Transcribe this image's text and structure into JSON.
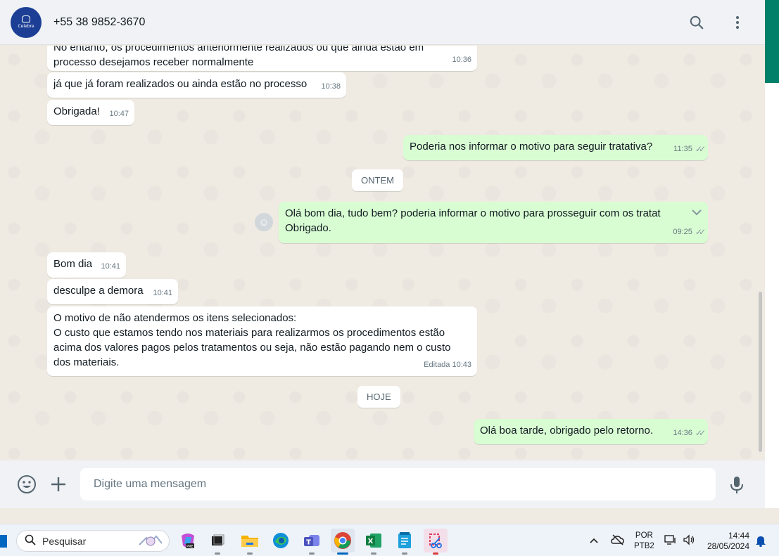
{
  "header": {
    "avatar_text": "Celebre",
    "contact_name": "+55 38 9852-3670",
    "search_icon": "search-icon",
    "menu_icon": "more-vertical-icon"
  },
  "messages": {
    "m1_text_line1": "No entanto, os procedimentos anteriormente realizados ou que ainda estão em",
    "m1_text_line2": "processo desejamos receber normalmente",
    "m1_time": "10:36",
    "m2_text": "já que já foram realizados ou ainda estão no processo",
    "m2_time": "10:38",
    "m3_text": "Obrigada!",
    "m3_time": "10:47",
    "m4_text": "Poderia nos informar o motivo para seguir tratativa?",
    "m4_time": "11:35",
    "day1": "ONTEM",
    "m5_text_line1": "Olá bom dia, tudo bem? poderia informar o motivo para prosseguir com os tratat",
    "m5_text_line2": "Obrigado.",
    "m5_time": "09:25",
    "m6_text": "Bom dia",
    "m6_time": "10:41",
    "m7_text": "desculpe a demora",
    "m7_time": "10:41",
    "m8_line1": "O motivo de não atendermos os itens selecionados:",
    "m8_line2": "O custo que estamos tendo nos materiais para realizarmos os procedimentos estão",
    "m8_line3": "acima dos valores pagos pelos tratamentos ou seja, não estão pagando nem o custo",
    "m8_line4": "dos materiais.",
    "m8_time": "Editada 10:43",
    "day2": "HOJE",
    "m9_text": "Olá boa tarde, obrigado pelo retorno.",
    "m9_time": "14:36"
  },
  "composer": {
    "placeholder": "Digite uma mensagem"
  },
  "taskbar": {
    "search_label": "Pesquisar",
    "lang_line1": "POR",
    "lang_line2": "PTB2",
    "time": "14:44",
    "date": "28/05/2024"
  },
  "colors": {
    "accent": "#008069",
    "outgoing_bubble": "#d9fdd3",
    "incoming_bubble": "#ffffff",
    "chat_bg": "#efeae2"
  }
}
